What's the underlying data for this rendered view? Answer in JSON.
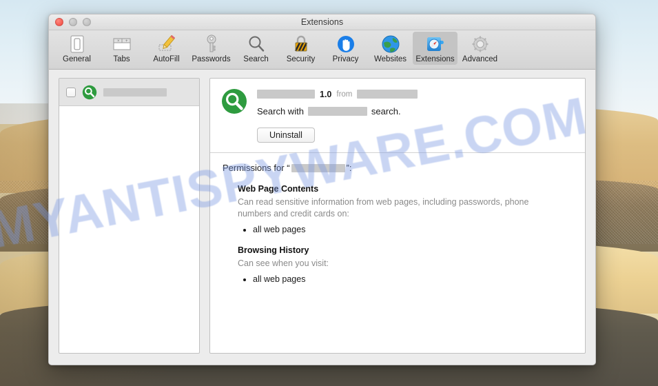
{
  "window": {
    "title": "Extensions",
    "traffic_lights": [
      "close",
      "minimize",
      "zoom"
    ]
  },
  "toolbar": {
    "items": [
      {
        "label": "General",
        "icon": "general-icon",
        "selected": false
      },
      {
        "label": "Tabs",
        "icon": "tabs-icon",
        "selected": false
      },
      {
        "label": "AutoFill",
        "icon": "autofill-icon",
        "selected": false
      },
      {
        "label": "Passwords",
        "icon": "passwords-icon",
        "selected": false
      },
      {
        "label": "Search",
        "icon": "search-icon",
        "selected": false
      },
      {
        "label": "Security",
        "icon": "security-icon",
        "selected": false
      },
      {
        "label": "Privacy",
        "icon": "privacy-icon",
        "selected": false
      },
      {
        "label": "Websites",
        "icon": "websites-icon",
        "selected": false
      },
      {
        "label": "Extensions",
        "icon": "extensions-icon",
        "selected": true
      },
      {
        "label": "Advanced",
        "icon": "advanced-icon",
        "selected": false
      }
    ]
  },
  "sidebar": {
    "extension": {
      "enabled": false,
      "name_redacted": true,
      "icon": "green-magnifier-icon"
    }
  },
  "detail": {
    "icon": "green-magnifier-icon",
    "name_redacted": true,
    "version": "1.0",
    "from_label": "from",
    "vendor_redacted": true,
    "description_prefix": "Search with",
    "description_suffix": "search.",
    "uninstall_label": "Uninstall"
  },
  "permissions": {
    "heading_prefix": "Permissions for “",
    "heading_suffix": "”:",
    "name_redacted": true,
    "groups": [
      {
        "title": "Web Page Contents",
        "text": "Can read sensitive information from web pages, including passwords, phone numbers and credit cards on:",
        "items": [
          "all web pages"
        ]
      },
      {
        "title": "Browsing History",
        "text": "Can see when you visit:",
        "items": [
          "all web pages"
        ]
      }
    ]
  },
  "watermark": {
    "text": "MYANTISPYWARE.COM"
  },
  "colors": {
    "extension_icon_green": "#2e9b3f",
    "selected_tab_bg": "#c4c4c4",
    "redaction_gray": "#c9c9c9",
    "watermark_blue": "#7896e1"
  }
}
